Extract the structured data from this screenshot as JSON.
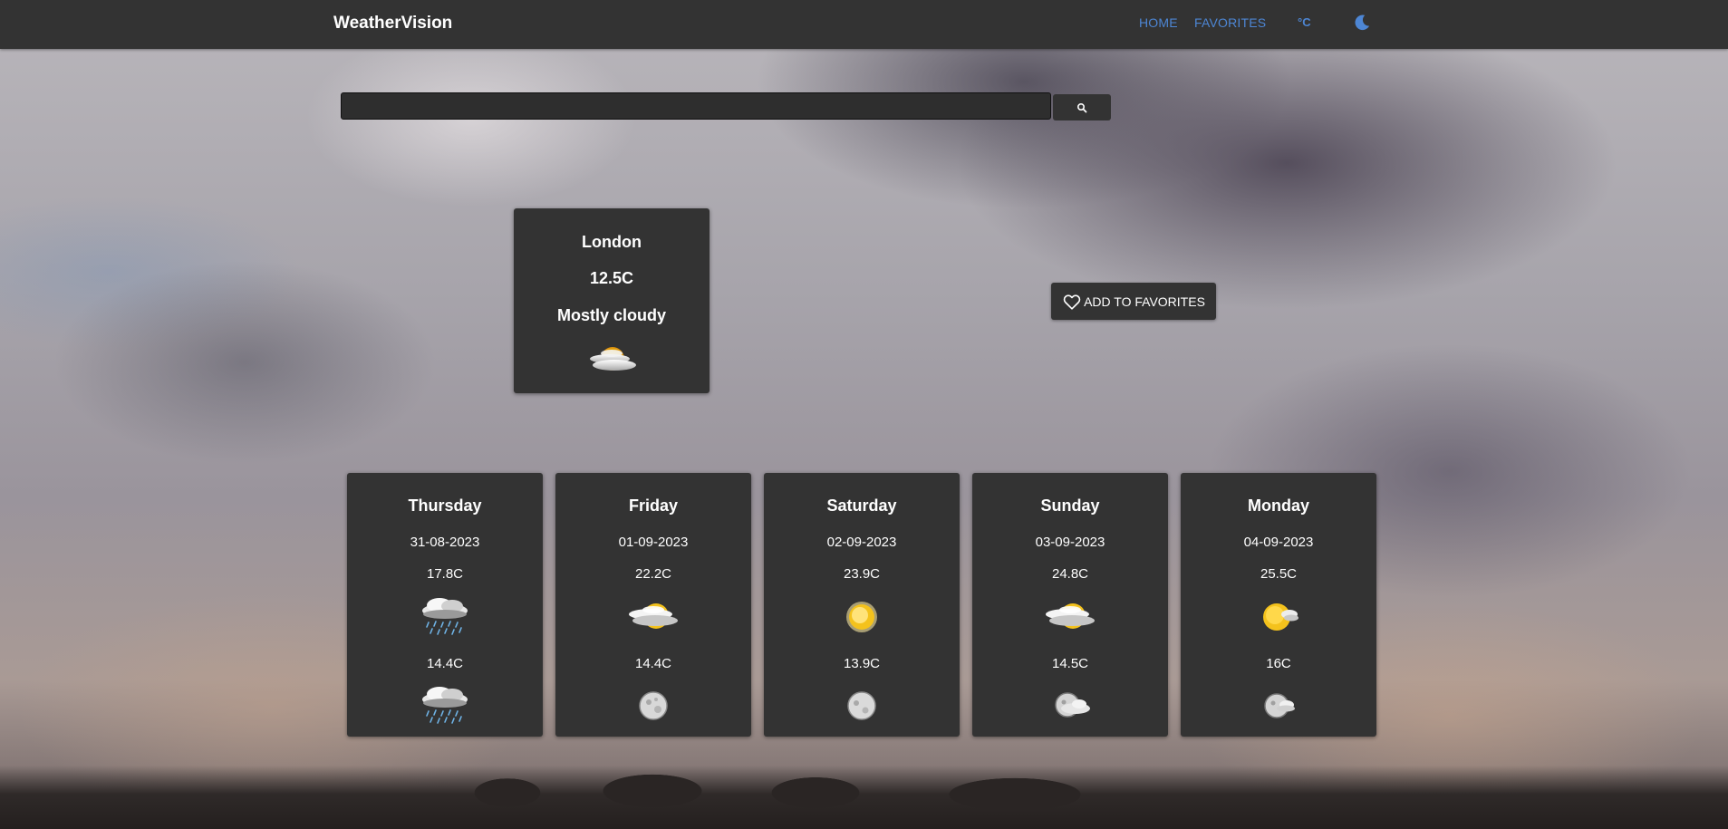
{
  "nav": {
    "brand": "WeatherVision",
    "home": "HOME",
    "favorites": "FAVORITES",
    "unit": "°C",
    "theme_icon": "moon-icon",
    "accent_color": "#4d86d4"
  },
  "search": {
    "value": "",
    "placeholder": "",
    "button_icon": "search-icon"
  },
  "current": {
    "city": "London",
    "temperature": "12.5C",
    "condition": "Mostly cloudy",
    "icon": "partly-cloudy-icon"
  },
  "favorite_button": {
    "label": "ADD TO FAVORITES",
    "icon": "heart-icon"
  },
  "forecast": [
    {
      "day": "Thursday",
      "date": "31-08-2023",
      "high": "17.8C",
      "day_icon": "rain-cloud-icon",
      "low": "14.4C",
      "night_icon": "rain-cloud-icon"
    },
    {
      "day": "Friday",
      "date": "01-09-2023",
      "high": "22.2C",
      "day_icon": "partly-cloudy-icon",
      "low": "14.4C",
      "night_icon": "moon-clear-icon"
    },
    {
      "day": "Saturday",
      "date": "02-09-2023",
      "high": "23.9C",
      "day_icon": "sunny-icon",
      "low": "13.9C",
      "night_icon": "moon-clear-icon"
    },
    {
      "day": "Sunday",
      "date": "03-09-2023",
      "high": "24.8C",
      "day_icon": "partly-cloudy-icon",
      "low": "14.5C",
      "night_icon": "moon-cloudy-icon"
    },
    {
      "day": "Monday",
      "date": "04-09-2023",
      "high": "25.5C",
      "day_icon": "mostly-sunny-icon",
      "low": "16C",
      "night_icon": "moon-cloudy-icon"
    }
  ],
  "colors": {
    "panel": "#333333",
    "text": "#ffffff"
  }
}
